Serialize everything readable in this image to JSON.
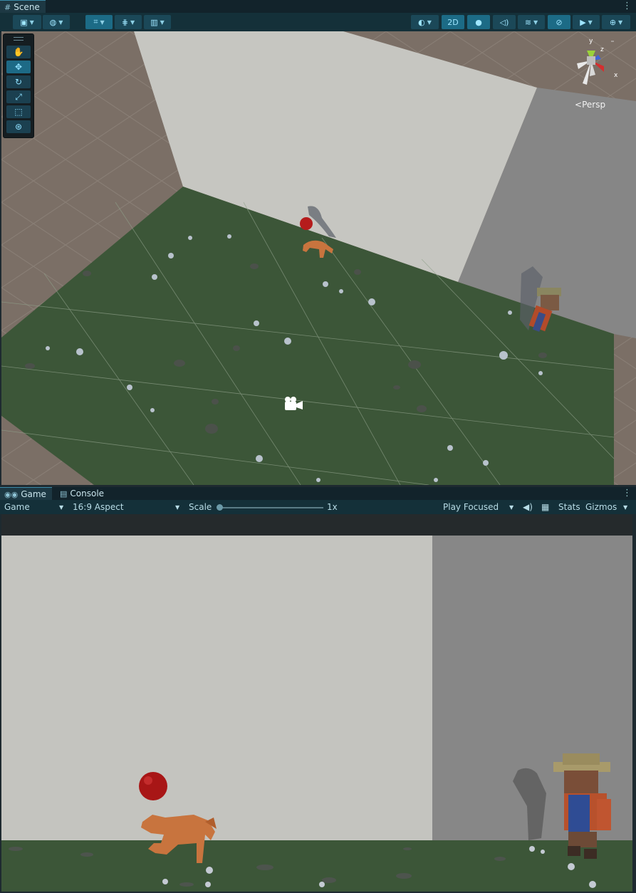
{
  "scene_panel": {
    "tab_label": "Scene",
    "persp_label": "Persp",
    "toggle_2d_label": "2D",
    "gizmo_axes": {
      "x": "x",
      "y": "y",
      "z": "z"
    },
    "tools": [
      "hand-icon",
      "move-icon",
      "rotate-icon",
      "scale-icon",
      "rect-icon",
      "transform-icon"
    ]
  },
  "game_panel": {
    "tabs": [
      {
        "label": "Game",
        "icon": "gamepad-icon"
      },
      {
        "label": "Console",
        "icon": "console-icon"
      }
    ],
    "display_label": "Game",
    "aspect_label": "16:9 Aspect",
    "scale_label": "Scale",
    "scale_value": "1x",
    "play_mode_label": "Play Focused",
    "stats_label": "Stats",
    "gizmos_label": "Gizmos"
  },
  "colors": {
    "editor_bg": "#143039",
    "accent": "#1c6b86",
    "grass": "#3b5538",
    "wall_light": "#c4c4bf",
    "wall_dark": "#878787",
    "ball": "#b51c1c",
    "dog": "#c8743e"
  }
}
